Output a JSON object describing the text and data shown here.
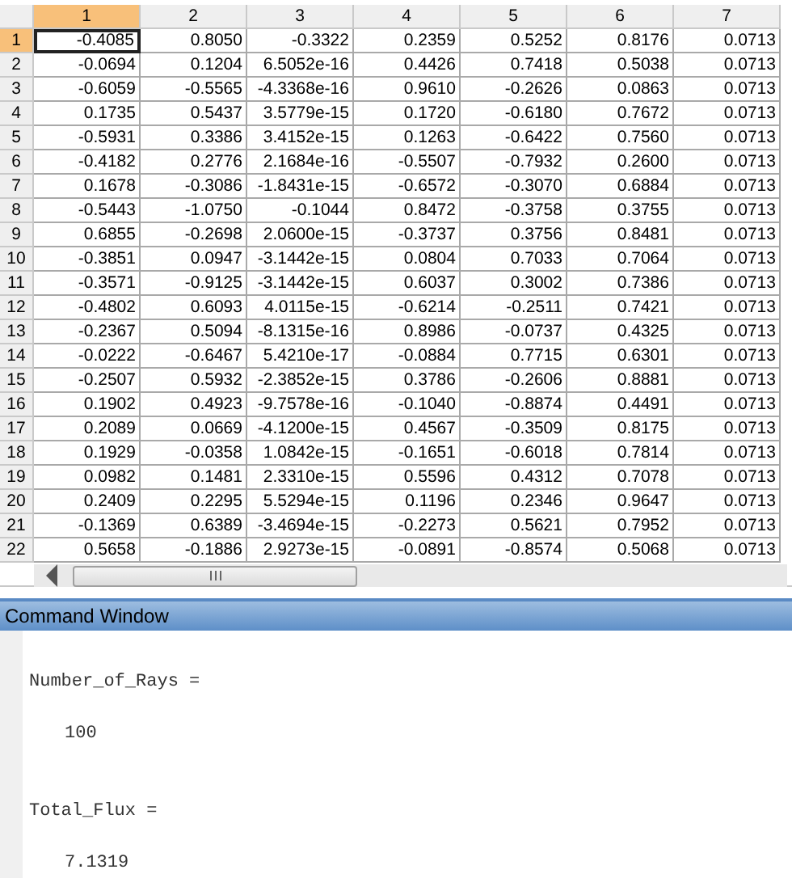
{
  "variable_editor": {
    "columns": [
      {
        "label": "1",
        "selected": true
      },
      {
        "label": "2",
        "selected": false
      },
      {
        "label": "3",
        "selected": false
      },
      {
        "label": "4",
        "selected": false
      },
      {
        "label": "5",
        "selected": false
      },
      {
        "label": "6",
        "selected": false
      },
      {
        "label": "7",
        "selected": false
      }
    ],
    "rows": [
      {
        "label": "1",
        "selected": true,
        "cells": [
          "-0.4085",
          "0.8050",
          "-0.3322",
          "0.2359",
          "0.5252",
          "0.8176",
          "0.0713"
        ]
      },
      {
        "label": "2",
        "selected": false,
        "cells": [
          "-0.0694",
          "0.1204",
          "6.5052e-16",
          "0.4426",
          "0.7418",
          "0.5038",
          "0.0713"
        ]
      },
      {
        "label": "3",
        "selected": false,
        "cells": [
          "-0.6059",
          "-0.5565",
          "-4.3368e-16",
          "0.9610",
          "-0.2626",
          "0.0863",
          "0.0713"
        ]
      },
      {
        "label": "4",
        "selected": false,
        "cells": [
          "0.1735",
          "0.5437",
          "3.5779e-15",
          "0.1720",
          "-0.6180",
          "0.7672",
          "0.0713"
        ]
      },
      {
        "label": "5",
        "selected": false,
        "cells": [
          "-0.5931",
          "0.3386",
          "3.4152e-15",
          "0.1263",
          "-0.6422",
          "0.7560",
          "0.0713"
        ]
      },
      {
        "label": "6",
        "selected": false,
        "cells": [
          "-0.4182",
          "0.2776",
          "2.1684e-16",
          "-0.5507",
          "-0.7932",
          "0.2600",
          "0.0713"
        ]
      },
      {
        "label": "7",
        "selected": false,
        "cells": [
          "0.1678",
          "-0.3086",
          "-1.8431e-15",
          "-0.6572",
          "-0.3070",
          "0.6884",
          "0.0713"
        ]
      },
      {
        "label": "8",
        "selected": false,
        "cells": [
          "-0.5443",
          "-1.0750",
          "-0.1044",
          "0.8472",
          "-0.3758",
          "0.3755",
          "0.0713"
        ]
      },
      {
        "label": "9",
        "selected": false,
        "cells": [
          "0.6855",
          "-0.2698",
          "2.0600e-15",
          "-0.3737",
          "0.3756",
          "0.8481",
          "0.0713"
        ]
      },
      {
        "label": "10",
        "selected": false,
        "cells": [
          "-0.3851",
          "0.0947",
          "-3.1442e-15",
          "0.0804",
          "0.7033",
          "0.7064",
          "0.0713"
        ]
      },
      {
        "label": "11",
        "selected": false,
        "cells": [
          "-0.3571",
          "-0.9125",
          "-3.1442e-15",
          "0.6037",
          "0.3002",
          "0.7386",
          "0.0713"
        ]
      },
      {
        "label": "12",
        "selected": false,
        "cells": [
          "-0.4802",
          "0.6093",
          "4.0115e-15",
          "-0.6214",
          "-0.2511",
          "0.7421",
          "0.0713"
        ]
      },
      {
        "label": "13",
        "selected": false,
        "cells": [
          "-0.2367",
          "0.5094",
          "-8.1315e-16",
          "0.8986",
          "-0.0737",
          "0.4325",
          "0.0713"
        ]
      },
      {
        "label": "14",
        "selected": false,
        "cells": [
          "-0.0222",
          "-0.6467",
          "5.4210e-17",
          "-0.0884",
          "0.7715",
          "0.6301",
          "0.0713"
        ]
      },
      {
        "label": "15",
        "selected": false,
        "cells": [
          "-0.2507",
          "0.5932",
          "-2.3852e-15",
          "0.3786",
          "-0.2606",
          "0.8881",
          "0.0713"
        ]
      },
      {
        "label": "16",
        "selected": false,
        "cells": [
          "0.1902",
          "0.4923",
          "-9.7578e-16",
          "-0.1040",
          "-0.8874",
          "0.4491",
          "0.0713"
        ]
      },
      {
        "label": "17",
        "selected": false,
        "cells": [
          "0.2089",
          "0.0669",
          "-4.1200e-15",
          "0.4567",
          "-0.3509",
          "0.8175",
          "0.0713"
        ]
      },
      {
        "label": "18",
        "selected": false,
        "cells": [
          "0.1929",
          "-0.0358",
          "1.0842e-15",
          "-0.1651",
          "-0.6018",
          "0.7814",
          "0.0713"
        ]
      },
      {
        "label": "19",
        "selected": false,
        "cells": [
          "0.0982",
          "0.1481",
          "2.3310e-15",
          "0.5596",
          "0.4312",
          "0.7078",
          "0.0713"
        ]
      },
      {
        "label": "20",
        "selected": false,
        "cells": [
          "0.2409",
          "0.2295",
          "5.5294e-15",
          "0.1196",
          "0.2346",
          "0.9647",
          "0.0713"
        ]
      },
      {
        "label": "21",
        "selected": false,
        "cells": [
          "-0.1369",
          "0.6389",
          "-3.4694e-15",
          "-0.2273",
          "0.5621",
          "0.7952",
          "0.0713"
        ]
      },
      {
        "label": "22",
        "selected": false,
        "cells": [
          "0.5658",
          "-0.1886",
          "2.9273e-15",
          "-0.0891",
          "-0.8574",
          "0.5068",
          "0.0713"
        ]
      }
    ]
  },
  "command_window": {
    "title": "Command Window",
    "lines": [
      {
        "kind": "name",
        "text": "Number_of_Rays ="
      },
      {
        "kind": "value",
        "text": "100"
      },
      {
        "kind": "name",
        "text": "Total_Flux ="
      },
      {
        "kind": "value",
        "text": "7.1319"
      }
    ]
  }
}
